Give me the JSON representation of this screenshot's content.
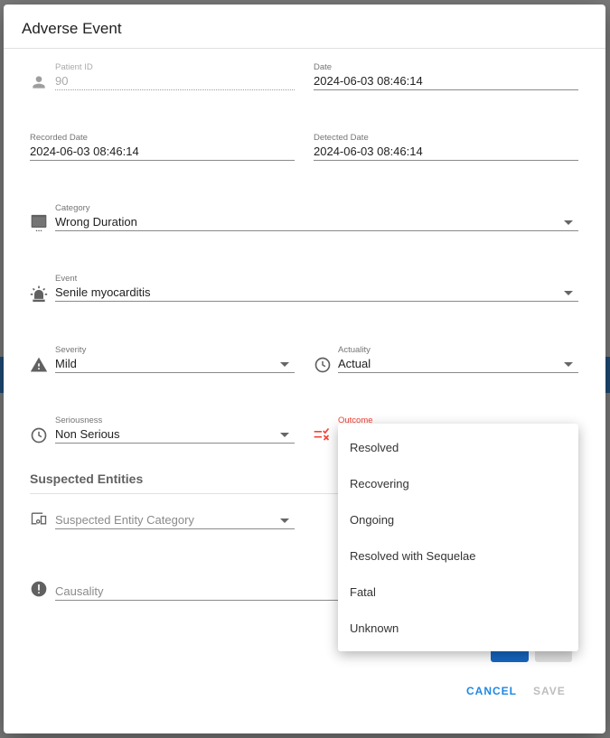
{
  "dialog": {
    "title": "Adverse Event"
  },
  "fields": {
    "patient_id": {
      "label": "Patient ID",
      "value": "90",
      "icon": "person-icon"
    },
    "date": {
      "label": "Date",
      "value": "2024-06-03 08:46:14"
    },
    "recorded_date": {
      "label": "Recorded Date",
      "value": "2024-06-03 08:46:14"
    },
    "detected_date": {
      "label": "Detected Date",
      "value": "2024-06-03 08:46:14"
    },
    "category": {
      "label": "Category",
      "value": "Wrong Duration",
      "icon": "category-icon"
    },
    "event": {
      "label": "Event",
      "value": "Senile myocarditis",
      "icon": "alarm-light-icon"
    },
    "severity": {
      "label": "Severity",
      "value": "Mild",
      "icon": "warning-icon"
    },
    "actuality": {
      "label": "Actuality",
      "value": "Actual",
      "icon": "clock-icon"
    },
    "seriousness": {
      "label": "Seriousness",
      "value": "Non Serious",
      "icon": "clock-icon"
    },
    "outcome": {
      "label": "Outcome",
      "icon": "list-check-x-icon"
    }
  },
  "suspected": {
    "heading": "Suspected Entities",
    "category_placeholder": "Suspected Entity Category",
    "causality_placeholder": "Causality"
  },
  "outcome_menu": {
    "options": [
      "Resolved",
      "Recovering",
      "Ongoing",
      "Resolved with Sequelae",
      "Fatal",
      "Unknown"
    ]
  },
  "actions": {
    "cancel": "CANCEL",
    "save": "SAVE"
  },
  "colors": {
    "accent": "#1976d2",
    "error": "#f44336",
    "disabled": "#bdbdbd"
  }
}
